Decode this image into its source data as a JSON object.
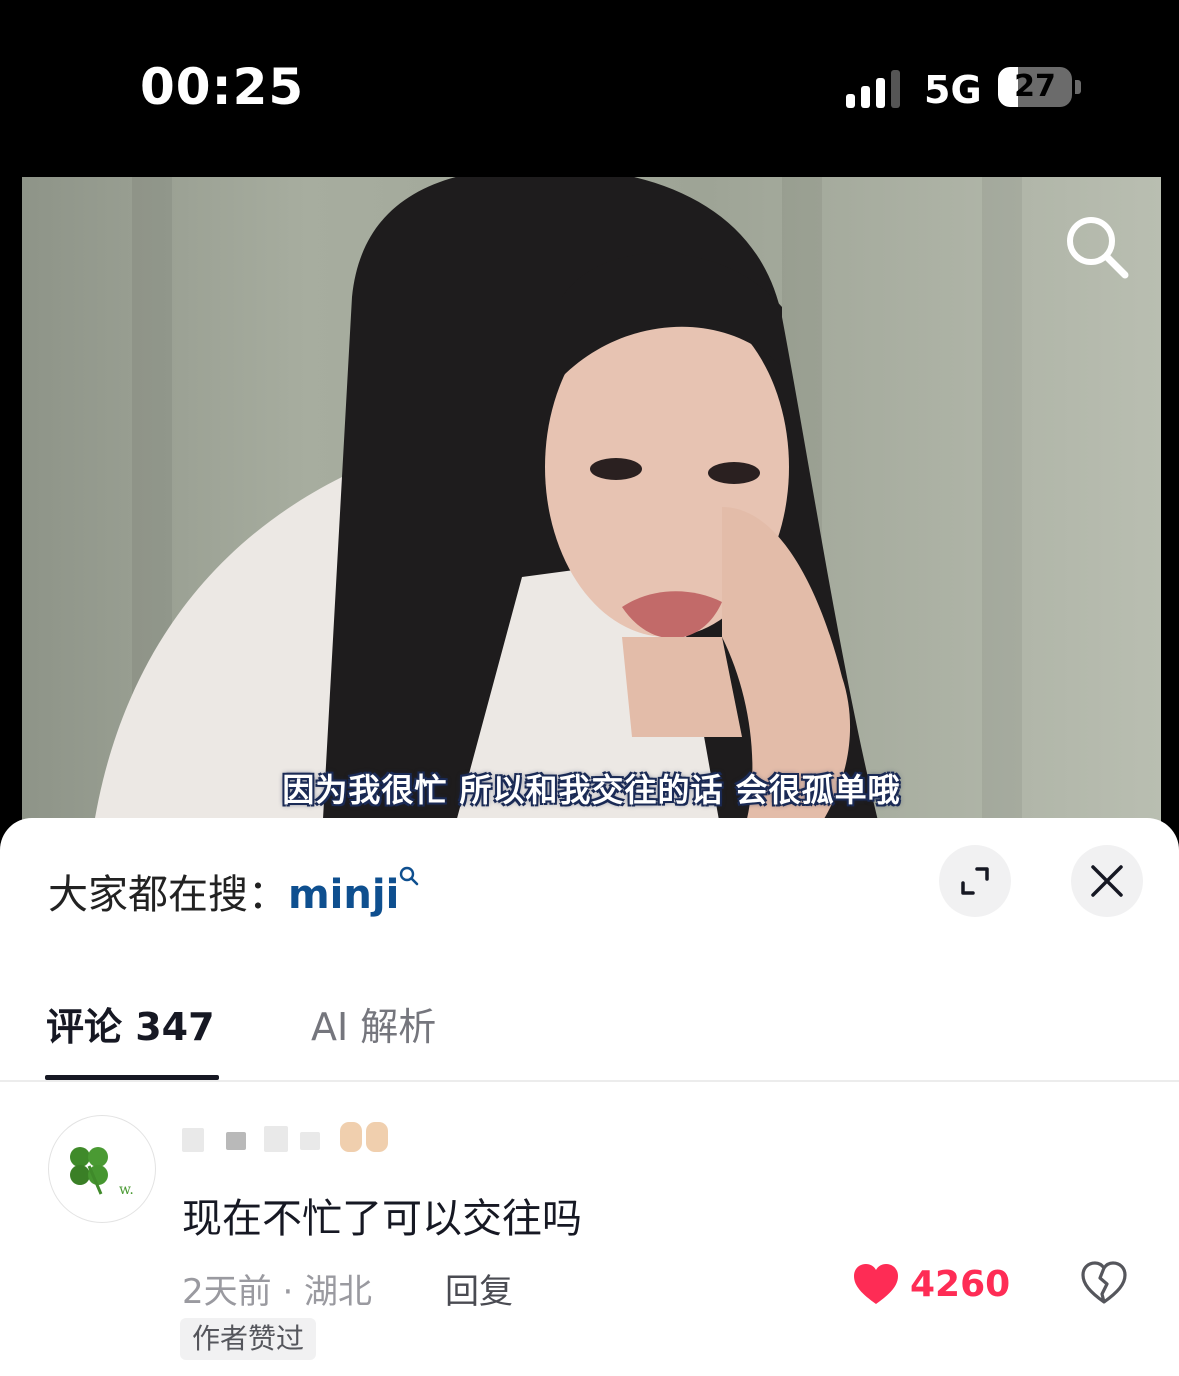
{
  "status_bar": {
    "time": "00:25",
    "network": "5G",
    "battery": "27",
    "battery_level": 0.27
  },
  "video": {
    "subtitle": "因为我很忙 所以和我交往的话 会很孤单哦",
    "search_icon": "search-icon"
  },
  "sheet": {
    "search_prompt_label": "大家都在搜：",
    "search_keyword": "minji",
    "expand_icon": "expand-icon",
    "close_icon": "close-icon",
    "tabs": [
      {
        "label": "评论 347",
        "active": true
      },
      {
        "label": "AI 解析",
        "active": false
      }
    ]
  },
  "comment": {
    "avatar_icon": "clover-avatar-icon",
    "text": "现在不忙了可以交往吗",
    "meta": "2天前 · 湖北",
    "reply_label": "回复",
    "like_count": "4260",
    "author_badge": "作者赞过",
    "like_color": "#fe2c55"
  }
}
